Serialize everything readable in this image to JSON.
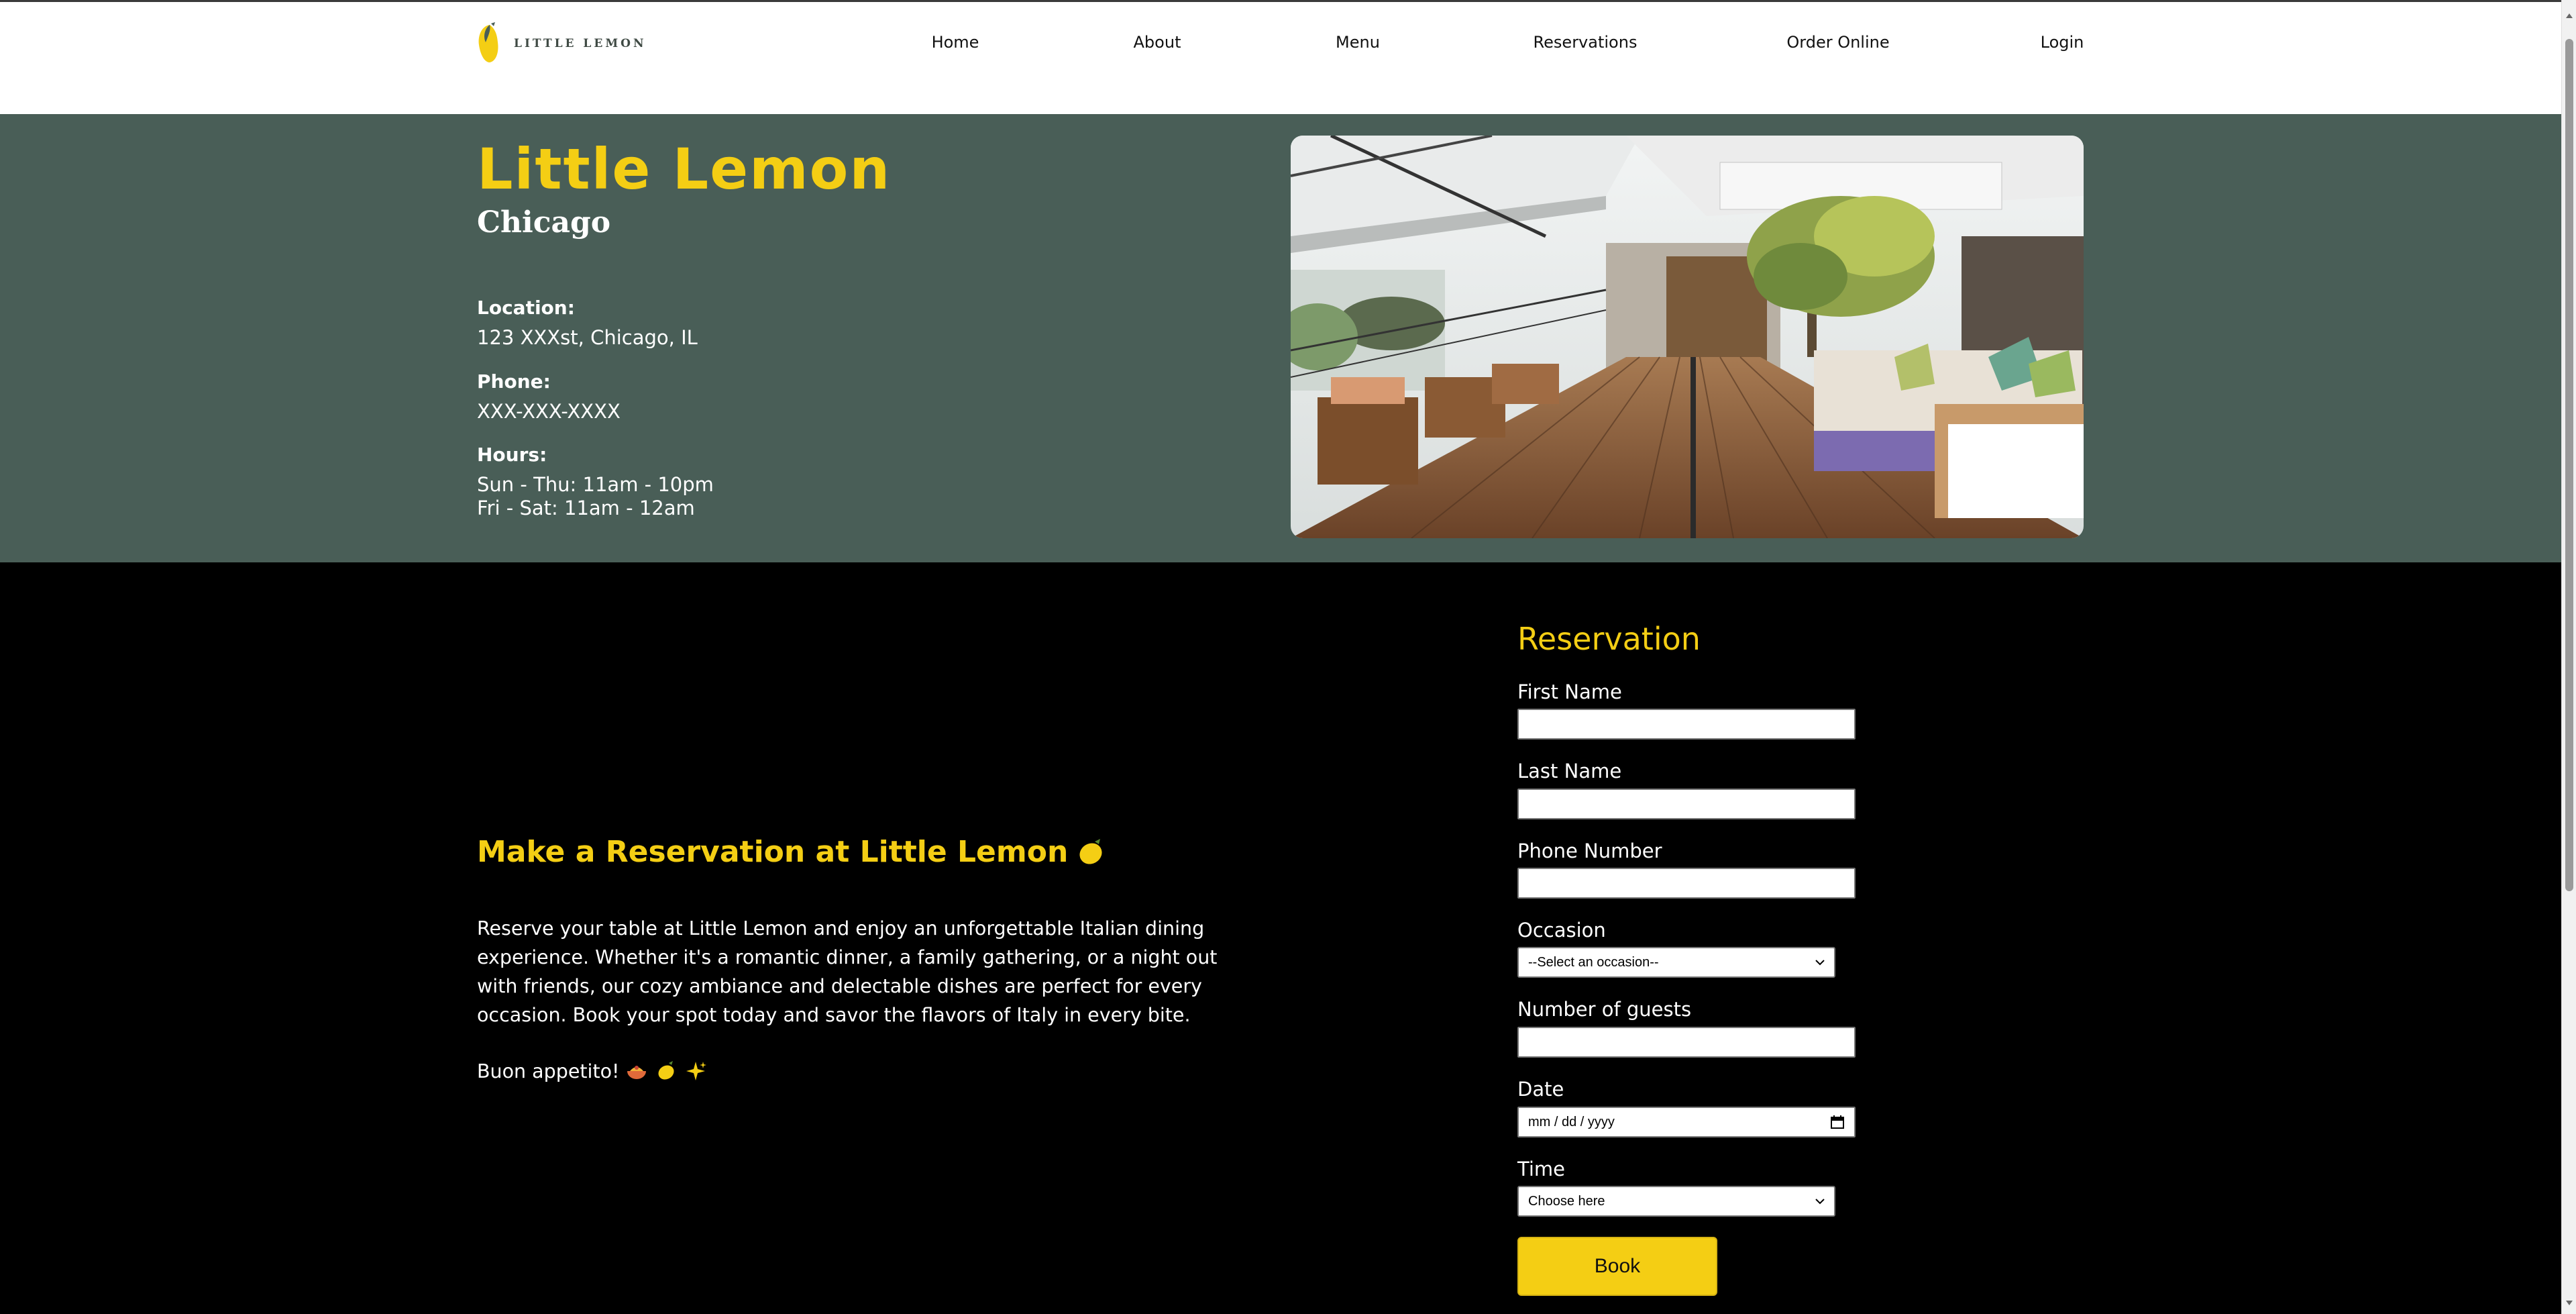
{
  "header": {
    "logo_text": "LITTLE LEMON",
    "nav": [
      {
        "label": "Home"
      },
      {
        "label": "About"
      },
      {
        "label": "Menu"
      },
      {
        "label": "Reservations"
      },
      {
        "label": "Order Online"
      },
      {
        "label": "Login"
      }
    ]
  },
  "hero": {
    "title": "Little Lemon",
    "city": "Chicago",
    "location_label": "Location:",
    "location_value": "123 XXXst, Chicago, IL",
    "phone_label": "Phone:",
    "phone_value": "XXX-XXX-XXXX",
    "hours_label": "Hours:",
    "hours_line1": "Sun - Thu: 11am - 10pm",
    "hours_line2": "Fri - Sat: 11am - 12am"
  },
  "promo": {
    "title": "Make a Reservation at Little Lemon",
    "body": "Reserve your table at Little Lemon and enjoy an unforgettable Italian dining experience. Whether it's a romantic dinner, a family gathering, or a night out with friends, our cozy ambiance and delectable dishes are perfect for every occasion. Book your spot today and savor the flavors of Italy in every bite.",
    "signoff": "Buon appetito!"
  },
  "form": {
    "title": "Reservation",
    "first_name_label": "First Name",
    "last_name_label": "Last Name",
    "phone_label": "Phone Number",
    "occasion_label": "Occasion",
    "occasion_selected": "--Select an occasion--",
    "guests_label": "Number of guests",
    "date_label": "Date",
    "date_placeholder": "mm / dd / yyyy",
    "time_label": "Time",
    "time_selected": "Choose here",
    "submit_label": "Book"
  },
  "colors": {
    "primary_green": "#495e57",
    "primary_yellow": "#f4ce14",
    "background": "#000000"
  }
}
